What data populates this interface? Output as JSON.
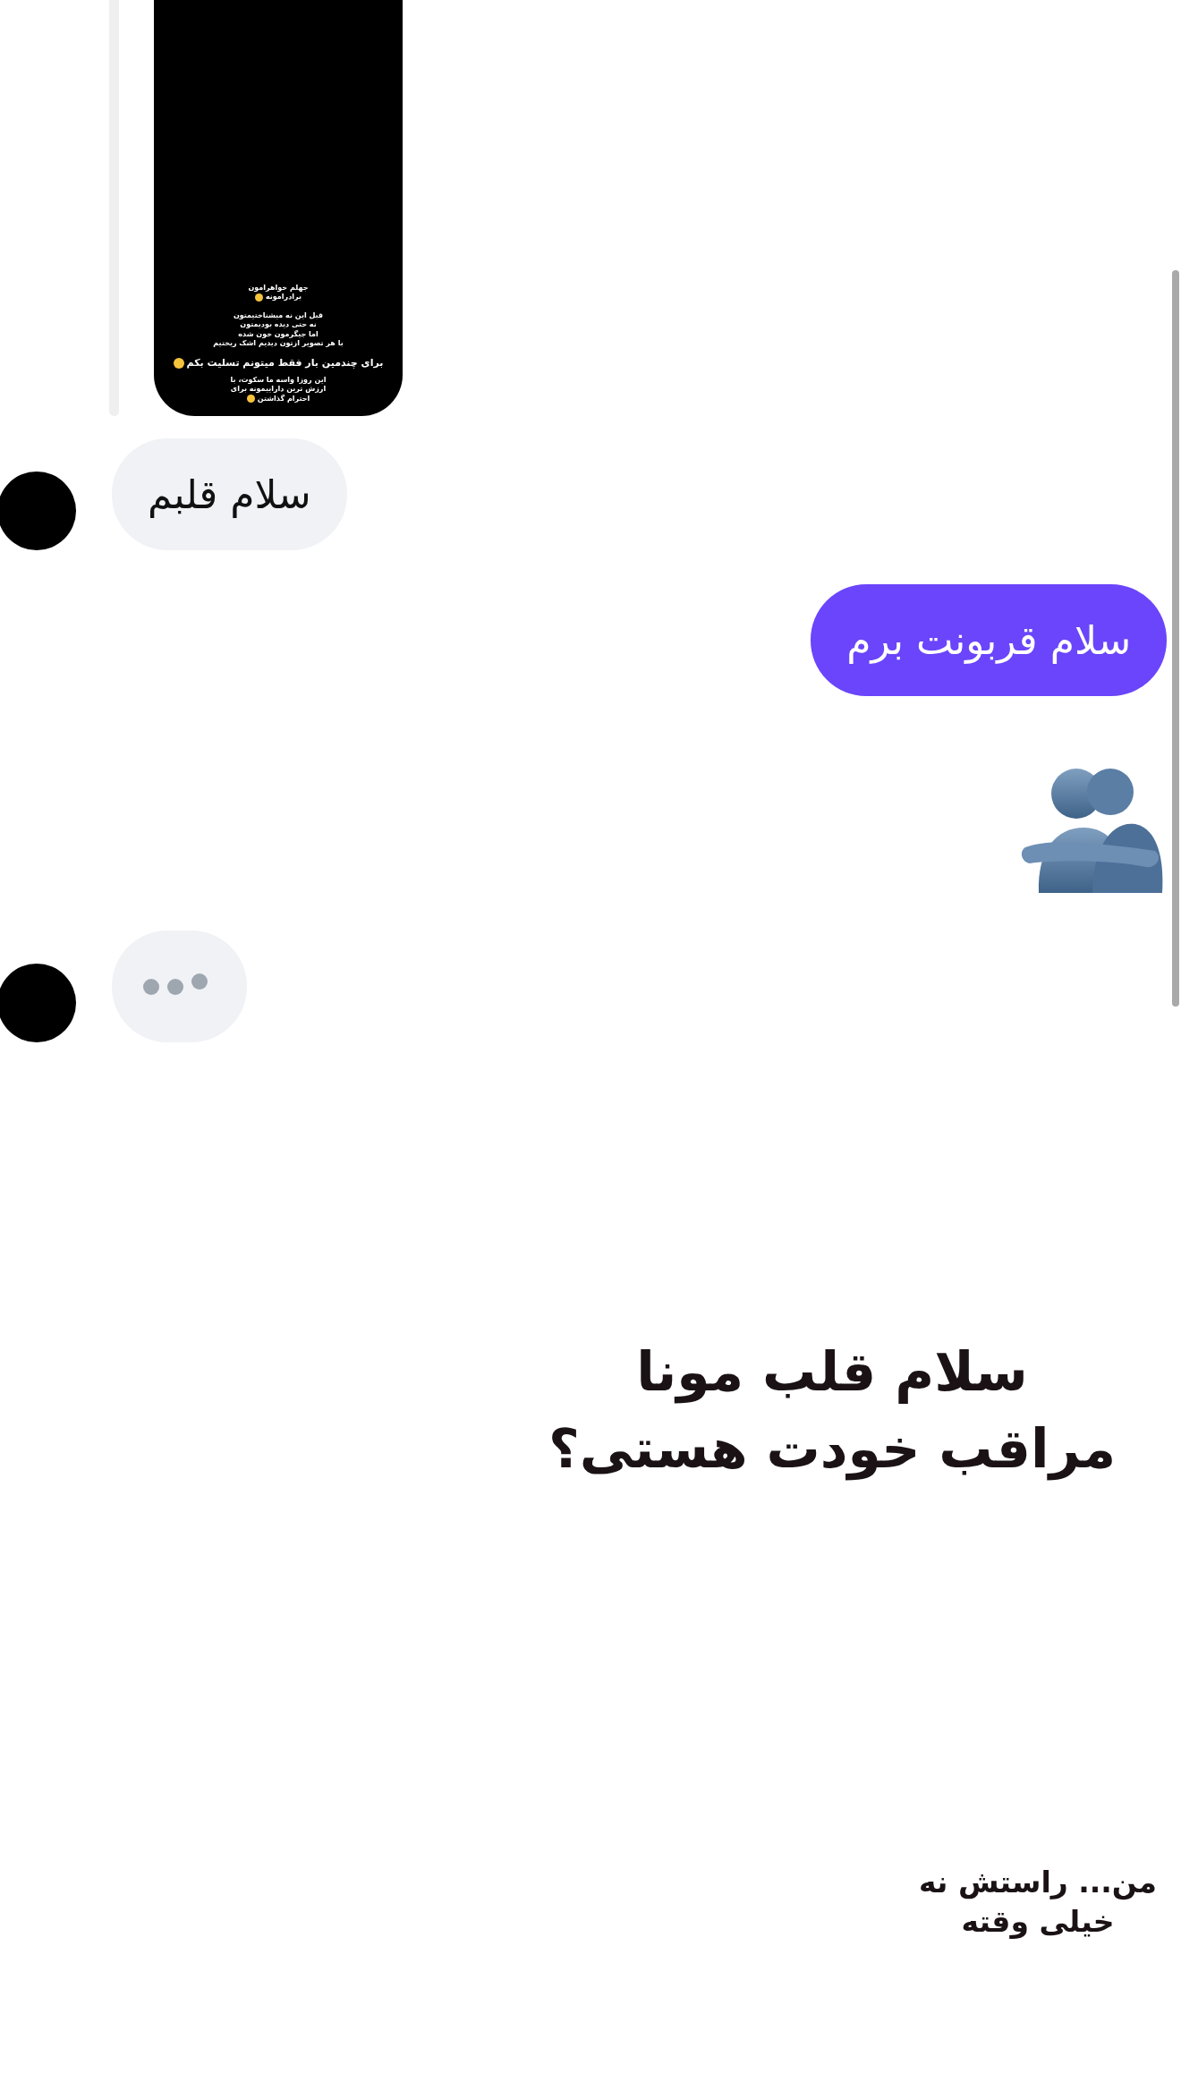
{
  "shared_story": {
    "paragraphs": [
      {
        "lines": [
          {
            "text": "جهلم خواهرامون",
            "kind": "small",
            "icon": false
          },
          {
            "text": "برادرامونه",
            "kind": "small",
            "icon": true
          }
        ]
      },
      {
        "lines": [
          {
            "text": "قبل این نه میشناختیمتون",
            "kind": "small",
            "icon": false
          },
          {
            "text": "نه حتی دیده بودیمتون",
            "kind": "small",
            "icon": false
          },
          {
            "text": "اما جیگرمون خون شده",
            "kind": "small",
            "icon": false
          },
          {
            "text": "با هر تصویر ازتون دیدیم اشک ریختیم",
            "kind": "small",
            "icon": false
          },
          {
            "text": "برای چندمین بار فقط میتونم تسلیت بکم",
            "kind": "large",
            "icon": true
          },
          {
            "text": "این روزا واسه ما سکوت، با",
            "kind": "small",
            "icon": false
          },
          {
            "text": "ارزش ترین داراییمونه برای",
            "kind": "small",
            "icon": false
          },
          {
            "text": "احترام گذاشتن",
            "kind": "small",
            "icon": true
          }
        ]
      }
    ]
  },
  "messages": [
    {
      "kind": "incoming_text",
      "text": "سلام قلبم"
    },
    {
      "kind": "outgoing_text",
      "text": "سلام قربونت برم"
    },
    {
      "kind": "outgoing_emoji"
    },
    {
      "kind": "incoming_typing"
    }
  ],
  "captions": [
    {
      "kind": "large",
      "lines": [
        "سلام قلب مونا",
        "مراقب خودت هستی؟"
      ]
    },
    {
      "kind": "small",
      "lines": [
        "من... راستش نه",
        "خیلی وقته"
      ]
    }
  ]
}
